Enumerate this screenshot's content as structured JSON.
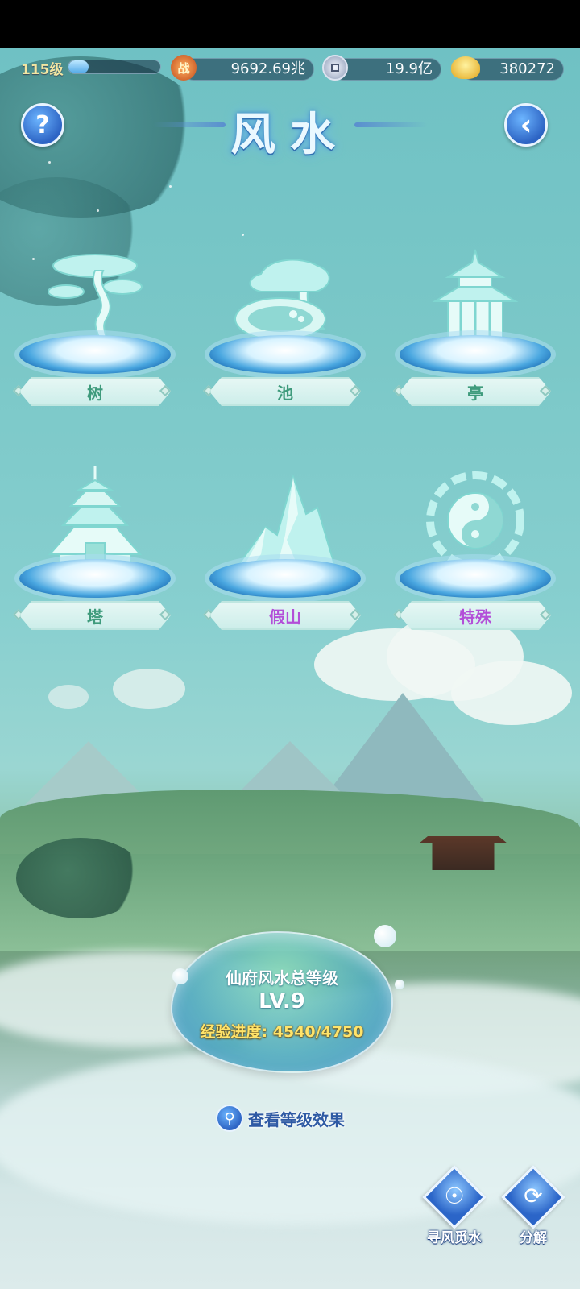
{
  "header": {
    "player_level": "115级",
    "level_progress": 0.22,
    "combat_power": "9692.69兆",
    "combat_icon_char": "战",
    "copper": "19.9亿",
    "gold": "380272"
  },
  "title": "风水",
  "buttons": {
    "help": "?",
    "back": "‹"
  },
  "items": [
    {
      "label": "树",
      "icon": "tree-icon",
      "color": "#3f9b7c"
    },
    {
      "label": "池",
      "icon": "pond-icon",
      "color": "#3f9b7c"
    },
    {
      "label": "亭",
      "icon": "pavilion-icon",
      "color": "#3f9b7c"
    },
    {
      "label": "塔",
      "icon": "pagoda-icon",
      "color": "#3f9b7c"
    },
    {
      "label": "假山",
      "icon": "mountain-icon",
      "color": "#b34fd8"
    },
    {
      "label": "特殊",
      "icon": "taiji-icon",
      "color": "#b34fd8"
    }
  ],
  "level_panel": {
    "title": "仙府风水总等级",
    "level": "LV.9",
    "exp_label": "经验进度:",
    "exp_value": "4540/4750",
    "view_effect": "查看等级效果"
  },
  "actions": {
    "seek": "寻风觅水",
    "decompose": "分解"
  }
}
